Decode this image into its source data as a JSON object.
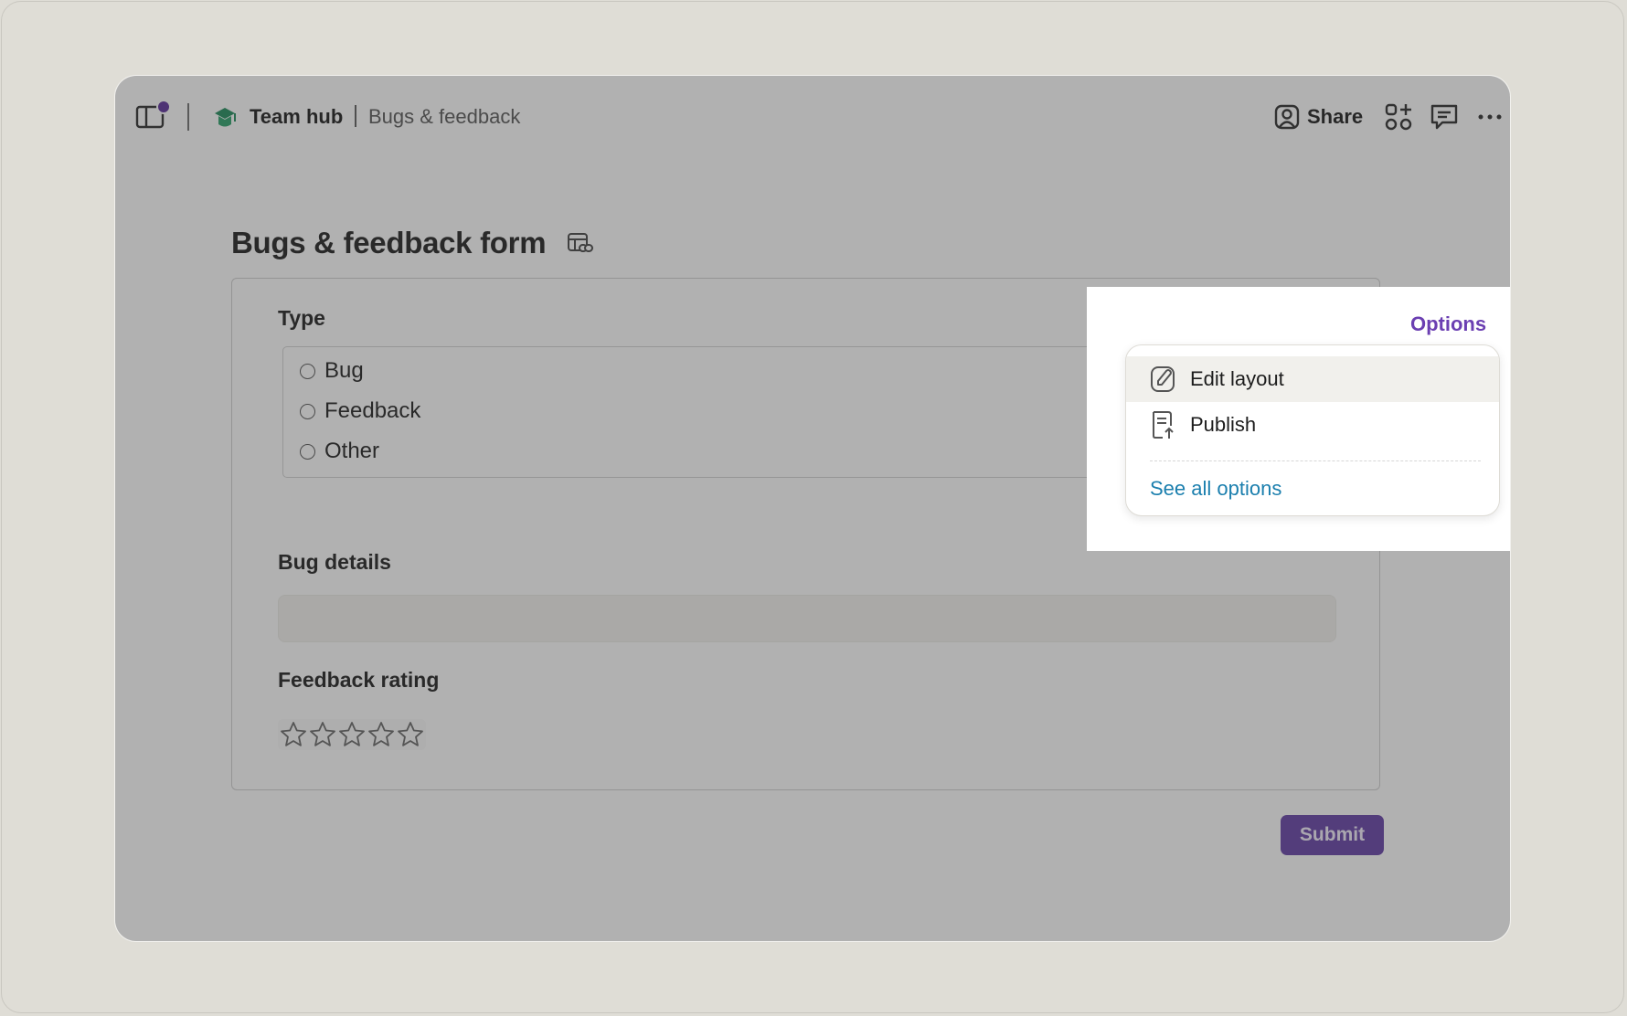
{
  "breadcrumb": {
    "workspace": "Team hub",
    "page": "Bugs & feedback"
  },
  "toolbar": {
    "share_label": "Share"
  },
  "form": {
    "title": "Bugs & feedback form",
    "type_label": "Type",
    "type_options": [
      "Bug",
      "Feedback",
      "Other"
    ],
    "bug_details_label": "Bug details",
    "bug_details_value": "",
    "rating_label": "Feedback rating",
    "rating_value": 0,
    "rating_max": 5,
    "submit_label": "Submit"
  },
  "options_menu": {
    "trigger_label": "Options",
    "items": [
      {
        "label": "Edit layout",
        "icon": "edit-layout-icon",
        "highlighted": true
      },
      {
        "label": "Publish",
        "icon": "publish-icon",
        "highlighted": false
      }
    ],
    "see_all_label": "See all options"
  },
  "colors": {
    "accent": "#633ea6",
    "link": "#1b7fae",
    "notification_dot": "#5b2d9a",
    "hub_icon": "#1f8a5b"
  }
}
